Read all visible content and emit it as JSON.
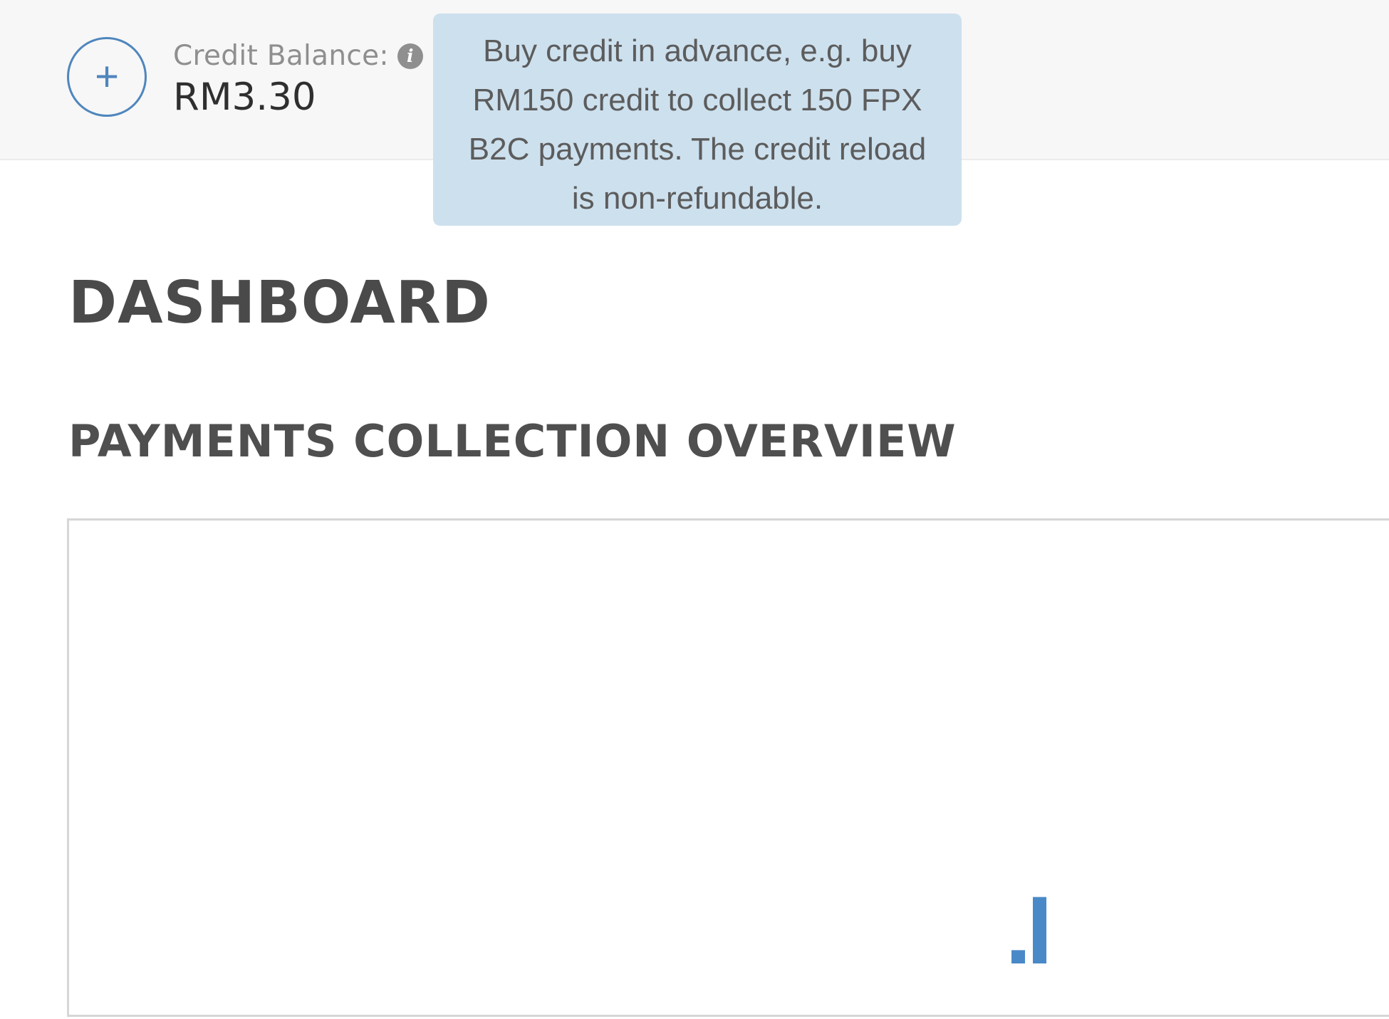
{
  "header": {
    "add_credit_symbol": "+",
    "credit_label": "Credit Balance:",
    "info_symbol": "i",
    "credit_value": "RM3.30"
  },
  "tooltip": {
    "text": "Buy credit in advance, e.g. buy RM150 credit to collect 150 FPX B2C payments. The credit reload is non-refundable."
  },
  "main": {
    "page_title": "DASHBOARD",
    "section_title": "PAYMENTS COLLECTION OVERVIEW"
  },
  "colors": {
    "accent": "#4f86bd",
    "tooltip_bg": "#cde0ee",
    "bar": "#4a89c8"
  },
  "chart_data": {
    "type": "bar",
    "categories": [
      "",
      ""
    ],
    "values": [
      1,
      5
    ],
    "ylim": [
      0,
      30
    ]
  }
}
